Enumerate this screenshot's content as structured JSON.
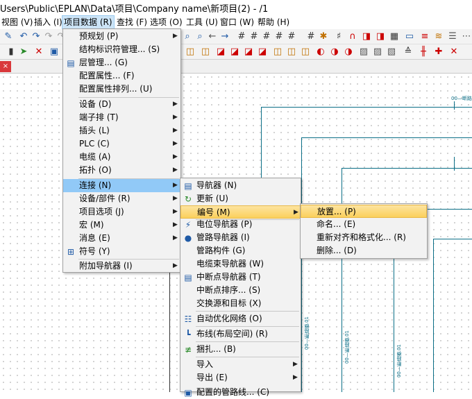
{
  "window": {
    "title": "Users\\Public\\EPLAN\\Data\\项目\\Company name\\新项目(2) - /1"
  },
  "menubar": [
    {
      "label": "视图 (V)",
      "active": false
    },
    {
      "label": "插入 (I)",
      "active": false
    },
    {
      "label": "项目数据 (R)",
      "active": true
    },
    {
      "label": "查找 (F)",
      "active": false
    },
    {
      "label": "选项 (O)",
      "active": false
    },
    {
      "label": "工具 (U)",
      "active": false
    },
    {
      "label": "窗口 (W)",
      "active": false
    },
    {
      "label": "帮助 (H)",
      "active": false
    }
  ],
  "project_data_menu": [
    {
      "label": "预规划 (P)",
      "submenu": true,
      "icon": ""
    },
    {
      "label": "结构标识符管理... (S)",
      "submenu": false,
      "icon": ""
    },
    {
      "label": "层管理... (G)",
      "submenu": false,
      "icon": "layers-icon"
    },
    {
      "label": "配置属性... (F)",
      "submenu": false,
      "icon": ""
    },
    {
      "label": "配置属性排列... (U)",
      "submenu": false,
      "icon": ""
    },
    {
      "label": "设备 (D)",
      "submenu": true,
      "icon": ""
    },
    {
      "label": "端子排 (T)",
      "submenu": true,
      "icon": ""
    },
    {
      "label": "插头 (L)",
      "submenu": true,
      "icon": ""
    },
    {
      "label": "PLC (C)",
      "submenu": true,
      "icon": ""
    },
    {
      "label": "电缆 (A)",
      "submenu": true,
      "icon": ""
    },
    {
      "label": "拓扑 (O)",
      "submenu": true,
      "icon": ""
    },
    {
      "label": "连接 (N)",
      "submenu": true,
      "icon": "",
      "highlighted": true
    },
    {
      "label": "设备/部件 (R)",
      "submenu": true,
      "icon": ""
    },
    {
      "label": "项目选项 (J)",
      "submenu": true,
      "icon": ""
    },
    {
      "label": "宏 (M)",
      "submenu": true,
      "icon": ""
    },
    {
      "label": "消息 (E)",
      "submenu": true,
      "icon": ""
    },
    {
      "label": "符号 (Y)",
      "submenu": false,
      "icon": "symbol-icon"
    },
    {
      "label": "附加导航器 (I)",
      "submenu": true,
      "icon": ""
    }
  ],
  "connection_menu": [
    {
      "label": "导航器 (N)",
      "submenu": false,
      "icon": "navigator-icon"
    },
    {
      "label": "更新 (U)",
      "submenu": false,
      "icon": "refresh-icon"
    },
    {
      "label": "编号 (M)",
      "submenu": true,
      "icon": "",
      "highlighted": true
    },
    {
      "label": "电位导航器 (P)",
      "submenu": false,
      "icon": "potential-icon"
    },
    {
      "label": "管路导航器 (I)",
      "submenu": false,
      "icon": "pipe-icon"
    },
    {
      "label": "管路构件 (G)",
      "submenu": false,
      "icon": ""
    },
    {
      "label": "电缆束导航器 (W)",
      "submenu": false,
      "icon": ""
    },
    {
      "label": "中断点导航器 (T)",
      "submenu": false,
      "icon": "interruption-icon"
    },
    {
      "label": "中断点排序... (S)",
      "submenu": false,
      "icon": ""
    },
    {
      "label": "交换源和目标 (X)",
      "submenu": false,
      "icon": ""
    },
    {
      "label": "自动优化网络 (O)",
      "submenu": false,
      "icon": "network-icon"
    },
    {
      "label": "布线(布局空间) (R)",
      "submenu": false,
      "icon": "routing-icon"
    },
    {
      "label": "捆扎... (B)",
      "submenu": false,
      "icon": "bundle-icon"
    },
    {
      "label": "导入",
      "submenu": true,
      "icon": ""
    },
    {
      "label": "导出 (E)",
      "submenu": true,
      "icon": ""
    },
    {
      "label": "配置的管路线... (C)",
      "submenu": false,
      "icon": "config-icon"
    }
  ],
  "numbering_menu": [
    {
      "label": "放置... (P)",
      "highlighted": true
    },
    {
      "label": "命名... (E)",
      "highlighted": false
    },
    {
      "label": "重新对齐和格式化... (R)",
      "highlighted": false
    },
    {
      "label": "删除... (D)",
      "highlighted": false
    }
  ],
  "drawing_labels": [
    "00—断路器",
    "00—断路器.01",
    "00—断路器.01",
    "00—断路器.01"
  ]
}
